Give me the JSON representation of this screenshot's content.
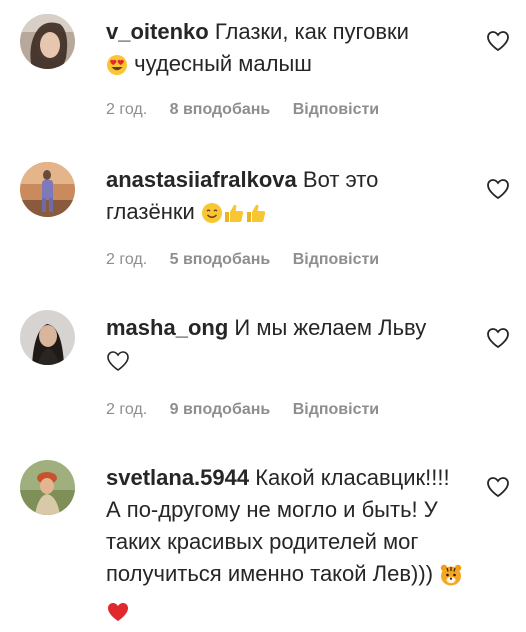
{
  "comments": [
    {
      "username": "v_oitenko",
      "text_before": "Глазки, как пуговки",
      "text_after": "чудесный малыш",
      "time": "2 год.",
      "likes": "8 вподобань",
      "reply": "Відповісти",
      "emojis": [
        "heart-eyes-emoji"
      ]
    },
    {
      "username": "anastasiiafralkova",
      "text_before": "Вот это глазёнки",
      "time": "2 год.",
      "likes": "5 вподобань",
      "reply": "Відповісти",
      "emojis": [
        "smiling-face-emoji",
        "thumbs-up-emoji",
        "thumbs-up-emoji"
      ]
    },
    {
      "username": "masha_ong",
      "text_before": "И мы желаем Льву",
      "time": "2 год.",
      "likes": "9 вподобань",
      "reply": "Відповісти",
      "emojis": [
        "white-heart-emoji"
      ]
    },
    {
      "username": "svetlana.5944",
      "text_before": "Какой класавцик!!!! А по-другому не могло и быть! У таких красивых родителей мог получиться именно такой Лев)))",
      "emojis": [
        "tiger-face-emoji",
        "red-heart-emoji"
      ]
    }
  ],
  "colors": {
    "text": "#262626",
    "meta": "#8e8e8e",
    "emoji_yellow": "#f7c631",
    "heart_red": "#e0282d"
  }
}
